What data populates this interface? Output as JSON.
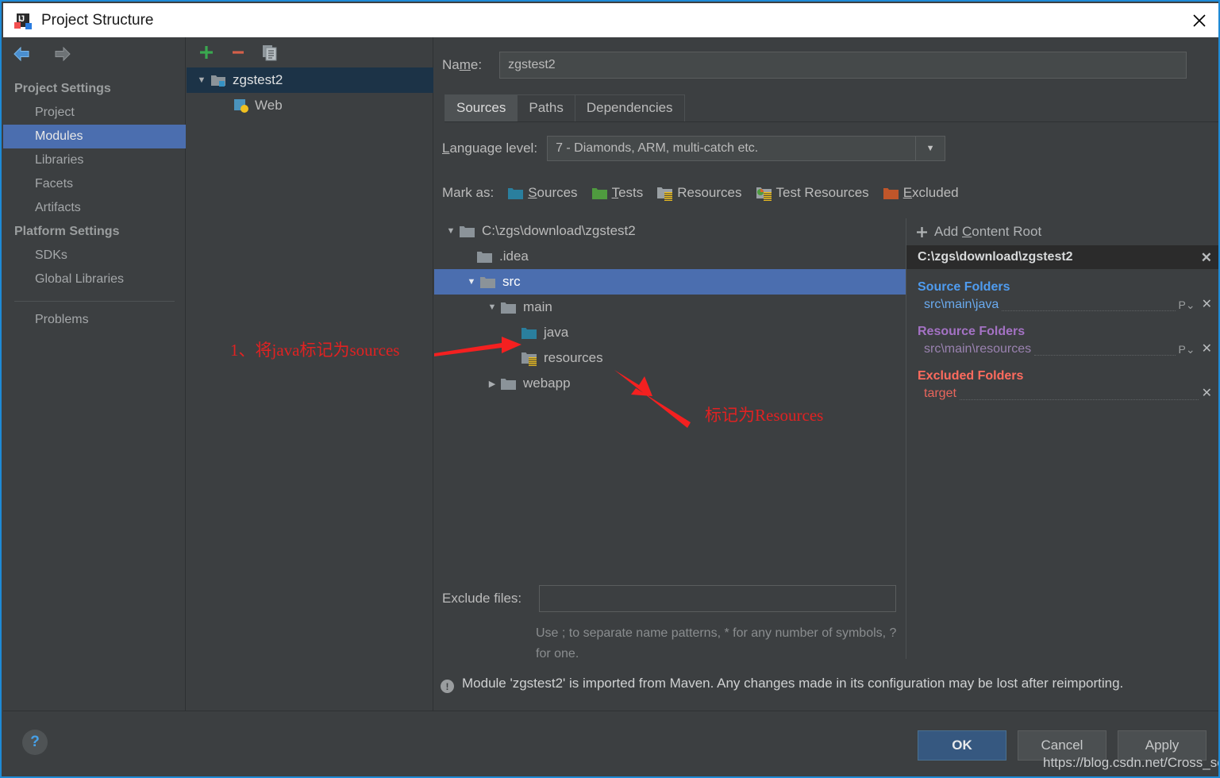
{
  "window": {
    "title": "Project Structure",
    "app_icon": "intellij-idea-icon",
    "close_icon": "close-icon"
  },
  "sidebar": {
    "back_icon": "back-arrow-icon",
    "forward_icon": "forward-arrow-icon",
    "groups": [
      {
        "header": "Project Settings",
        "items": [
          {
            "label": "Project",
            "selected": false
          },
          {
            "label": "Modules",
            "selected": true
          },
          {
            "label": "Libraries",
            "selected": false
          },
          {
            "label": "Facets",
            "selected": false
          },
          {
            "label": "Artifacts",
            "selected": false
          }
        ]
      },
      {
        "header": "Platform Settings",
        "items": [
          {
            "label": "SDKs",
            "selected": false
          },
          {
            "label": "Global Libraries",
            "selected": false
          }
        ]
      }
    ],
    "problems": "Problems"
  },
  "modules_panel": {
    "toolbar": {
      "add_icon": "plus-icon",
      "remove_icon": "minus-icon",
      "copy_icon": "copy-icon"
    },
    "tree": [
      {
        "label": "zgstest2",
        "icon": "module-folder-icon",
        "expanded": true,
        "indent": 0,
        "selected": true
      },
      {
        "label": "Web",
        "icon": "web-facet-icon",
        "expanded": null,
        "indent": 1,
        "selected": false
      }
    ]
  },
  "main": {
    "name_label": "Name:",
    "name_value": "zgstest2",
    "tabs": [
      {
        "label": "Sources",
        "active": true
      },
      {
        "label": "Paths",
        "active": false
      },
      {
        "label": "Dependencies",
        "active": false
      }
    ],
    "language_level_label": "Language level:",
    "language_level_value": "7 - Diamonds, ARM, multi-catch etc.",
    "language_level_arrow_icon": "chevron-down-icon",
    "mark_as_label": "Mark as:",
    "mark_as_options": [
      {
        "label": "Sources",
        "color": "#2a7f9e",
        "icon": "sources-folder-icon"
      },
      {
        "label": "Tests",
        "color": "#4f9b3f",
        "icon": "tests-folder-icon"
      },
      {
        "label": "Resources",
        "color": "#9aa0a4",
        "icon": "resources-folder-icon"
      },
      {
        "label": "Test Resources",
        "color": "#9aa0a4",
        "icon": "test-resources-folder-icon"
      },
      {
        "label": "Excluded",
        "color": "#c0562a",
        "icon": "excluded-folder-icon"
      }
    ],
    "source_tree": [
      {
        "label": "C:\\zgs\\download\\zgstest2",
        "indent": 0,
        "expanded": true,
        "folder": "plain",
        "selected": false
      },
      {
        "label": ".idea",
        "indent": 1,
        "expanded": null,
        "folder": "plain",
        "selected": false
      },
      {
        "label": "src",
        "indent": 1,
        "expanded": true,
        "folder": "plain",
        "selected": true
      },
      {
        "label": "main",
        "indent": 2,
        "expanded": true,
        "folder": "plain",
        "selected": false
      },
      {
        "label": "java",
        "indent": 3,
        "expanded": null,
        "folder": "sources",
        "selected": false
      },
      {
        "label": "resources",
        "indent": 3,
        "expanded": null,
        "folder": "resources",
        "selected": false
      },
      {
        "label": "webapp",
        "indent": 2,
        "expanded": false,
        "folder": "plain",
        "selected": false
      }
    ],
    "exclude_files_label": "Exclude files:",
    "exclude_files_value": "",
    "exclude_hint": "Use ; to separate name patterns, * for any number of symbols, ? for one.",
    "warning_icon": "info-icon",
    "warning_text": "Module 'zgstest2' is imported from Maven. Any changes made in its configuration may be lost after reimporting."
  },
  "root_panel": {
    "add_content_root_label": "Add Content Root",
    "add_icon": "plus-icon",
    "content_root_path": "C:\\zgs\\download\\zgstest2",
    "content_root_remove_icon": "close-icon",
    "groups": [
      {
        "title": "Source Folders",
        "title_color": "#4f9cf0",
        "item_color": "#6aabf0",
        "folders": [
          {
            "path": "src\\main\\java",
            "has_package_prefix": true,
            "package_icon": "package-prefix-icon",
            "remove_icon": "close-icon"
          }
        ]
      },
      {
        "title": "Resource Folders",
        "title_color": "#a472c4",
        "item_color": "#9a82b0",
        "folders": [
          {
            "path": "src\\main\\resources",
            "has_package_prefix": true,
            "package_icon": "package-prefix-icon",
            "remove_icon": "close-icon"
          }
        ]
      },
      {
        "title": "Excluded Folders",
        "title_color": "#ff6b5e",
        "item_color": "#e8655c",
        "folders": [
          {
            "path": "target",
            "has_package_prefix": false,
            "package_icon": "",
            "remove_icon": "close-icon"
          }
        ]
      }
    ]
  },
  "footer": {
    "help_label": "?",
    "help_icon": "help-icon",
    "ok_label": "OK",
    "cancel_label": "Cancel",
    "apply_label": "Apply"
  },
  "annotations": [
    {
      "text": "1、将java标记为sources",
      "color": "#e02222"
    },
    {
      "text": "标记为Resources",
      "color": "#e02222"
    }
  ],
  "watermark": "https://blog.csdn.net/Cross_self"
}
